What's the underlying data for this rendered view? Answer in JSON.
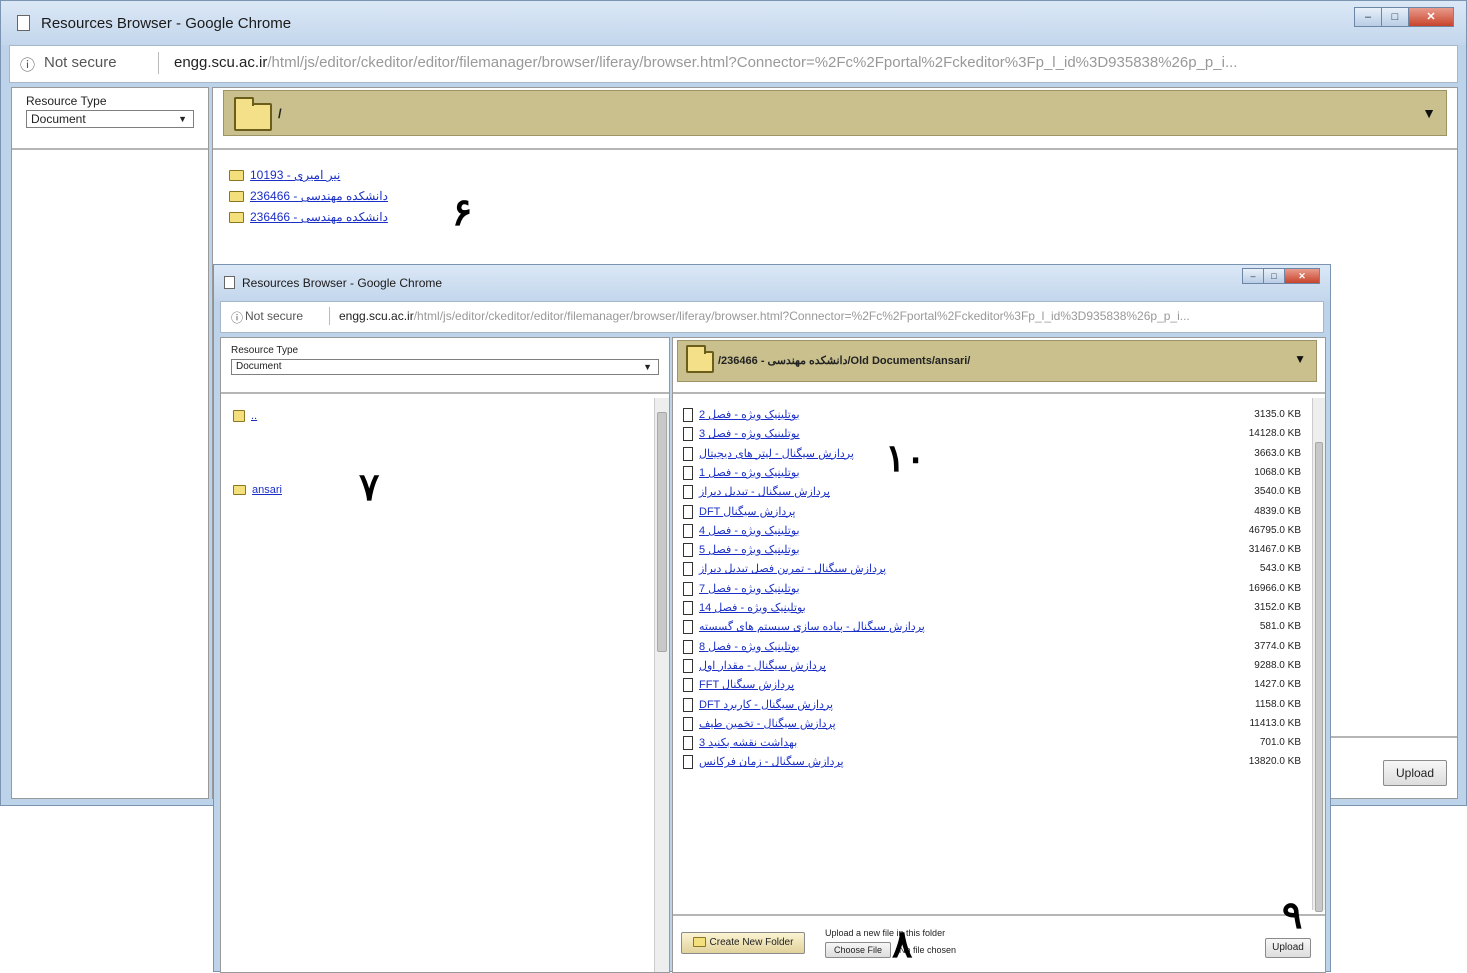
{
  "back_window": {
    "title": "Resources Browser - Google Chrome",
    "address": {
      "info_icon": "ⓘ",
      "security": "Not secure",
      "host": "engg.scu.ac.ir",
      "path": "/html/js/editor/ckeditor/editor/filemanager/browser/liferay/browser.html?Connector=%2Fc%2Fportal%2Fckeditor%3Fp_l_id%3D935838%26p_p_i..."
    },
    "resource_type_label": "Resource Type",
    "resource_type_value": "Document",
    "current_path": "/",
    "folders": [
      "نیر امیری - 10193",
      "دانشکده مهندسی - 236466",
      "دانشکده مهندسی - 236466"
    ],
    "upload_button": "Upload"
  },
  "front_window": {
    "title": "Resources Browser - Google Chrome",
    "address": {
      "info_icon": "ⓘ",
      "security": "Not secure",
      "host": "engg.scu.ac.ir",
      "path": "/html/js/editor/ckeditor/editor/filemanager/browser/liferay/browser.html?Connector=%2Fc%2Fportal%2Fckeditor%3Fp_l_id%3D935838%26p_p_i..."
    },
    "resource_type_label": "Resource Type",
    "resource_type_value": "Document",
    "current_path": "/236466 - دانشکده مهندسی/Old Documents/ansari/",
    "up_folder_label": "..",
    "subfolder": "ansari",
    "files": [
      {
        "name": "بوتلینیک ویژه - فصل 2",
        "size": "3135.0 KB"
      },
      {
        "name": "بوتلینیک ویژه - فصل 3",
        "size": "14128.0 KB"
      },
      {
        "name": "پردازش سیگنال - لیتر های دیجیتال",
        "size": "3663.0 KB"
      },
      {
        "name": "بوتلینیک ویژه - فصل 1",
        "size": "1068.0 KB"
      },
      {
        "name": "پردازش سیگنال - تبدیل دیراز",
        "size": "3540.0 KB"
      },
      {
        "name": "DFT پردازش سیگنال",
        "size": "4839.0 KB"
      },
      {
        "name": "بوتلینیک ویژه - فصل 4",
        "size": "46795.0 KB"
      },
      {
        "name": "بوتلینیک ویژه - فصل 5",
        "size": "31467.0 KB"
      },
      {
        "name": "پردازش سیگنال - تمرین فصل تبدیل دیراز",
        "size": "543.0 KB"
      },
      {
        "name": "بوتلینیک ویژه - فصل 7",
        "size": "16966.0 KB"
      },
      {
        "name": "بوتلینیک ویژه - فصل 14",
        "size": "3152.0 KB"
      },
      {
        "name": "پردازش سیگنال - پیاده سازی سیستم های گسسته",
        "size": "581.0 KB"
      },
      {
        "name": "بوتلینیک ویژه - فصل 8",
        "size": "3774.0 KB"
      },
      {
        "name": "پردازش سیگنال - مقدار اول",
        "size": "9288.0 KB"
      },
      {
        "name": "FFT پردازش سیگنال",
        "size": "1427.0 KB"
      },
      {
        "name": "DFT پردازش سیگنال - کاربرد",
        "size": "1158.0 KB"
      },
      {
        "name": "پردازش سیگنال - تخمین طیف",
        "size": "11413.0 KB"
      },
      {
        "name": "بهداشت نقشه بکنید 3",
        "size": "701.0 KB"
      },
      {
        "name": "پردازش سیگنال - زمان فرکانس",
        "size": "13820.0 KB"
      }
    ],
    "create_folder_button": "Create New Folder",
    "upload_prompt": "Upload a new file in this folder",
    "choose_file_button": "Choose File",
    "no_file_text": "No file chosen",
    "upload_button": "Upload"
  },
  "annotations": {
    "six": "۶",
    "seven": "۷",
    "eight": "۸",
    "nine": "۹",
    "ten": "۱۰"
  },
  "colors": {
    "folder_bar": "#c9c08e",
    "link": "#1b2fc7",
    "chrome_frame": "#bcd3ea"
  }
}
